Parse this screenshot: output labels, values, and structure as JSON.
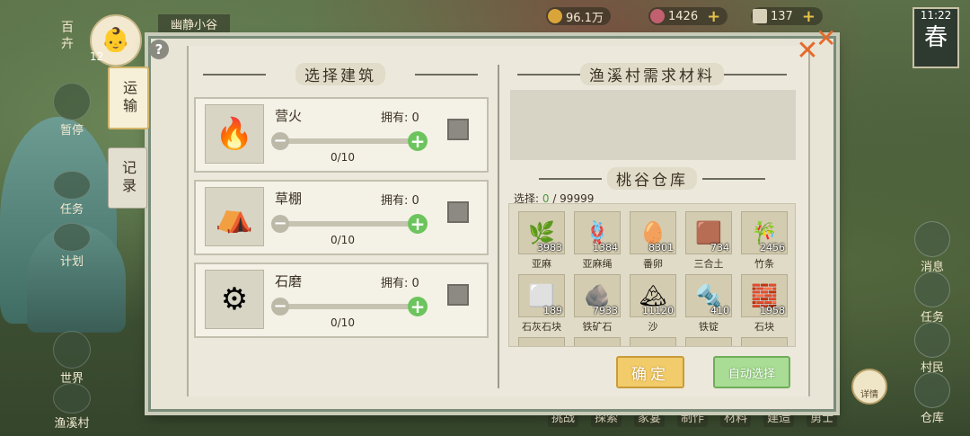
{
  "hud": {
    "village_name": "幽静小谷",
    "level": "12",
    "badge": "百卉",
    "coins": "96.1万",
    "gems": "1426",
    "tickets": "137",
    "time": "11:22",
    "season": "春"
  },
  "left_menu": [
    {
      "label": "暂停"
    },
    {
      "label": "任务"
    },
    {
      "label": "计划"
    },
    {
      "label": "世界"
    },
    {
      "label": "渔溪村"
    }
  ],
  "right_menu": [
    {
      "label": "消息"
    },
    {
      "label": "任务"
    },
    {
      "label": "村民"
    },
    {
      "label": "仓库"
    }
  ],
  "bottom_menu": [
    "挑战",
    "探索",
    "家宴",
    "制作",
    "材料",
    "建造",
    "勇士"
  ],
  "detail_label": "详情",
  "tabs": [
    "运输",
    "记录"
  ],
  "left_section_title": "选择建筑",
  "buildings": [
    {
      "name": "营火",
      "own_label": "拥有: 0",
      "count": "0/10",
      "fill": 0,
      "icon": "campfire-icon"
    },
    {
      "name": "草棚",
      "own_label": "拥有: 0",
      "count": "0/10",
      "fill": 0,
      "icon": "hut-icon"
    },
    {
      "name": "石磨",
      "own_label": "拥有: 0",
      "count": "0/10",
      "fill": 0,
      "icon": "millstone-icon"
    }
  ],
  "need_title": "渔溪村需求材料",
  "storage_title": "桃谷仓库",
  "selection": {
    "label": "选择: ",
    "selected": "0",
    "max": " / 99999"
  },
  "materials": [
    {
      "name": "亚麻",
      "qty": "3983",
      "icon": "flax-icon",
      "glyph": "🌿"
    },
    {
      "name": "亚麻绳",
      "qty": "1384",
      "icon": "rope-icon",
      "glyph": "🪢"
    },
    {
      "name": "番卵",
      "qty": "8301",
      "icon": "egg-icon",
      "glyph": "🥚"
    },
    {
      "name": "三合土",
      "qty": "734",
      "icon": "soil-icon",
      "glyph": "🟫"
    },
    {
      "name": "竹条",
      "qty": "2456",
      "icon": "bamboo-icon",
      "glyph": "🎋"
    },
    {
      "name": "石灰石块",
      "qty": "189",
      "icon": "limestone-icon",
      "glyph": "⬜"
    },
    {
      "name": "铁矿石",
      "qty": "7933",
      "icon": "iron-ore-icon",
      "glyph": "🪨"
    },
    {
      "name": "沙",
      "qty": "11120",
      "icon": "sand-icon",
      "glyph": "🏔"
    },
    {
      "name": "铁锭",
      "qty": "410",
      "icon": "ingot-icon",
      "glyph": "🔩"
    },
    {
      "name": "石块",
      "qty": "1958",
      "icon": "stone-icon",
      "glyph": "🧱"
    }
  ],
  "buttons": {
    "confirm": "确定",
    "auto_select": "自动选择"
  },
  "colors": {
    "confirm": "#f2cc6a",
    "auto": "#a9dc95",
    "plus": "#6cc45c"
  }
}
